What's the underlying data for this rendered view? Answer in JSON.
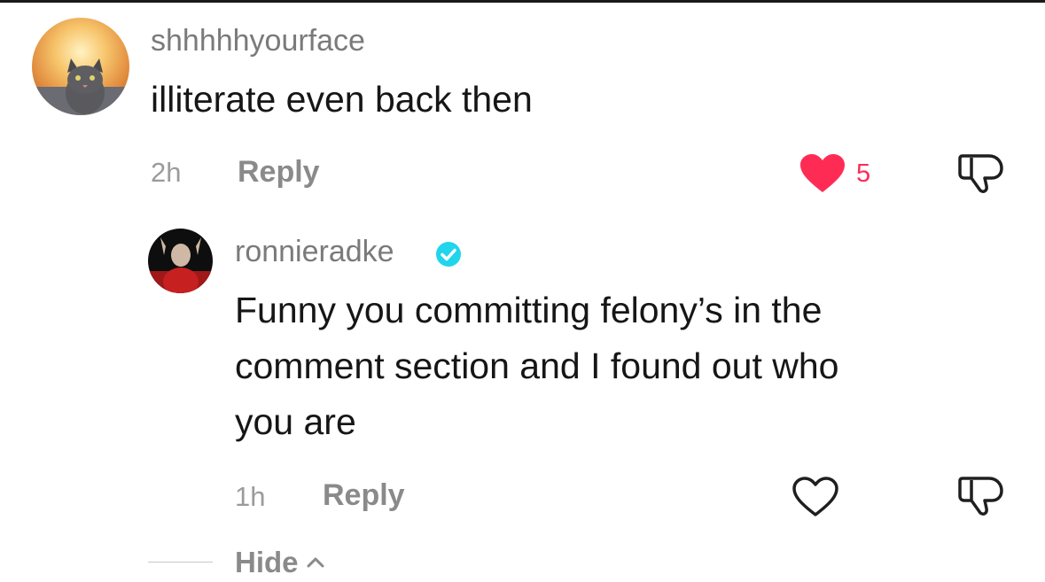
{
  "comments": [
    {
      "username": "shhhhhyourface",
      "text": "illiterate even back then",
      "time": "2h",
      "reply_label": "Reply",
      "liked": true,
      "like_count": "5"
    }
  ],
  "reply": {
    "username": "ronnieradke",
    "verified": true,
    "text_lines": [
      "Funny you committing felony’s in the",
      "comment section and I found out who",
      "you are"
    ],
    "time": "1h",
    "reply_label": "Reply",
    "liked": false
  },
  "hide_label": "Hide",
  "colors": {
    "like_red": "#fe2c55",
    "verified_blue": "#20d5ec",
    "muted_gray": "#8a8a8a"
  },
  "icons": [
    "heart-filled-icon",
    "dislike-icon",
    "heart-outline-icon",
    "verified-badge-icon",
    "chevron-up-icon"
  ]
}
